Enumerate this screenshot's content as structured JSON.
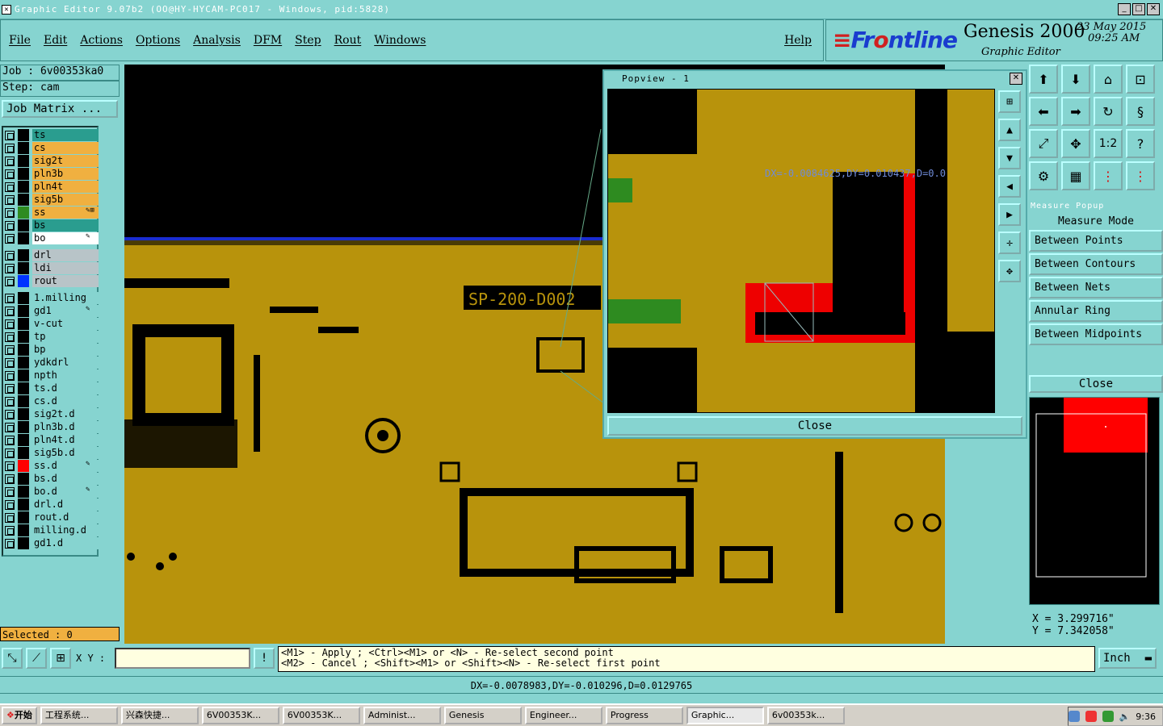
{
  "window": {
    "title": "Graphic Editor 9.07b2 (OO@HY-HYCAM-PC017 - Windows, pid:5828)"
  },
  "menu": {
    "items": [
      "File",
      "Edit",
      "Actions",
      "Options",
      "Analysis",
      "DFM",
      "Step",
      "Rout",
      "Windows"
    ],
    "help": "Help"
  },
  "brand": {
    "logo_prefix": "Fr",
    "logo_suffix": "ntline",
    "product": "Genesis 2000",
    "subtitle": "Graphic Editor",
    "date": "23 May 2015",
    "time": "09:25 AM"
  },
  "job": {
    "line": "Job : 6v00353ka0",
    "step": "Step: cam",
    "matrix_button": "Job Matrix ..."
  },
  "layers": [
    {
      "name": "ts",
      "color": "#2a9d8f",
      "swatch": "#000",
      "mark": ""
    },
    {
      "name": "cs",
      "color": "#f0b040",
      "swatch": "#000",
      "mark": ""
    },
    {
      "name": "sig2t",
      "color": "#f0b040",
      "swatch": "#000",
      "mark": ""
    },
    {
      "name": "pln3b",
      "color": "#f0b040",
      "swatch": "#000",
      "mark": ""
    },
    {
      "name": "pln4t",
      "color": "#f0b040",
      "swatch": "#000",
      "mark": ""
    },
    {
      "name": "sig5b",
      "color": "#f0b040",
      "swatch": "#000",
      "mark": ""
    },
    {
      "name": "ss",
      "color": "#f0b040",
      "swatch": "#2e8b20",
      "mark": "✎⊞"
    },
    {
      "name": "bs",
      "color": "#2a9d8f",
      "swatch": "#000",
      "mark": ""
    },
    {
      "name": "bo",
      "color": "#ffffff",
      "swatch": "#000",
      "mark": "✎"
    },
    {
      "name": "drl",
      "color": "#b8c4c8",
      "swatch": "#000",
      "mark": ""
    },
    {
      "name": "ldi",
      "color": "#b8c4c8",
      "swatch": "#000",
      "mark": ""
    },
    {
      "name": "rout",
      "color": "#b8c4c8",
      "swatch": "#0033ff",
      "mark": ""
    },
    {
      "name": "1.milling",
      "color": "#86d4d0",
      "swatch": "#000",
      "mark": ""
    },
    {
      "name": "gd1",
      "color": "#86d4d0",
      "swatch": "#000",
      "mark": "✎"
    },
    {
      "name": "v-cut",
      "color": "#86d4d0",
      "swatch": "#000",
      "mark": ""
    },
    {
      "name": "tp",
      "color": "#86d4d0",
      "swatch": "#000",
      "mark": ""
    },
    {
      "name": "bp",
      "color": "#86d4d0",
      "swatch": "#000",
      "mark": ""
    },
    {
      "name": "ydkdrl",
      "color": "#86d4d0",
      "swatch": "#000",
      "mark": ""
    },
    {
      "name": "npth",
      "color": "#86d4d0",
      "swatch": "#000",
      "mark": ""
    },
    {
      "name": "ts.d",
      "color": "#86d4d0",
      "swatch": "#000",
      "mark": ""
    },
    {
      "name": "cs.d",
      "color": "#86d4d0",
      "swatch": "#000",
      "mark": ""
    },
    {
      "name": "sig2t.d",
      "color": "#86d4d0",
      "swatch": "#000",
      "mark": ""
    },
    {
      "name": "pln3b.d",
      "color": "#86d4d0",
      "swatch": "#000",
      "mark": ""
    },
    {
      "name": "pln4t.d",
      "color": "#86d4d0",
      "swatch": "#000",
      "mark": ""
    },
    {
      "name": "sig5b.d",
      "color": "#86d4d0",
      "swatch": "#000",
      "mark": ""
    },
    {
      "name": "ss.d",
      "color": "#86d4d0",
      "swatch": "#ff0000",
      "mark": "✎"
    },
    {
      "name": "bs.d",
      "color": "#86d4d0",
      "swatch": "#000",
      "mark": ""
    },
    {
      "name": "bo.d",
      "color": "#86d4d0",
      "swatch": "#000",
      "mark": "✎"
    },
    {
      "name": "drl.d",
      "color": "#86d4d0",
      "swatch": "#000",
      "mark": ""
    },
    {
      "name": "rout.d",
      "color": "#86d4d0",
      "swatch": "#000",
      "mark": ""
    },
    {
      "name": "milling.d",
      "color": "#86d4d0",
      "swatch": "#000",
      "mark": ""
    },
    {
      "name": "gd1.d",
      "color": "#86d4d0",
      "swatch": "#000",
      "mark": ""
    }
  ],
  "selected": "Selected : 0",
  "board": {
    "text": "SP-200-D002"
  },
  "popview": {
    "title": "Popview - 1",
    "measure": "DX=-0.0084625,DY=0.010437,D=0.0",
    "close": "Close"
  },
  "measure_popup": {
    "title": "Measure Popup",
    "mode": "Measure Mode",
    "options": [
      "Between Points",
      "Between Contours",
      "Between Nets",
      "Annular Ring",
      "Between Midpoints"
    ],
    "close": "Close"
  },
  "coords": {
    "x": "X = 3.299716\"",
    "y": "Y = 7.342058\""
  },
  "bottom": {
    "xy_label": "X Y :",
    "xy_value": "",
    "hint1": "<M1> - Apply  ; <Ctrl><M1> or <N> - Re-select second point",
    "hint2": "<M2> - Cancel ; <Shift><M1> or <Shift><N> - Re-select first point",
    "units": "Inch"
  },
  "status": "DX=-0.0078983,DY=-0.010296,D=0.0129765",
  "taskbar": {
    "start": "开始",
    "items": [
      "工程系统...",
      "兴森快捷...",
      "6V00353K...",
      "6V00353K...",
      "Administ...",
      "Genesis",
      "Engineer...",
      "Progress",
      "Graphic...",
      "6v00353k..."
    ],
    "active_index": 8,
    "clock": "9:36"
  }
}
